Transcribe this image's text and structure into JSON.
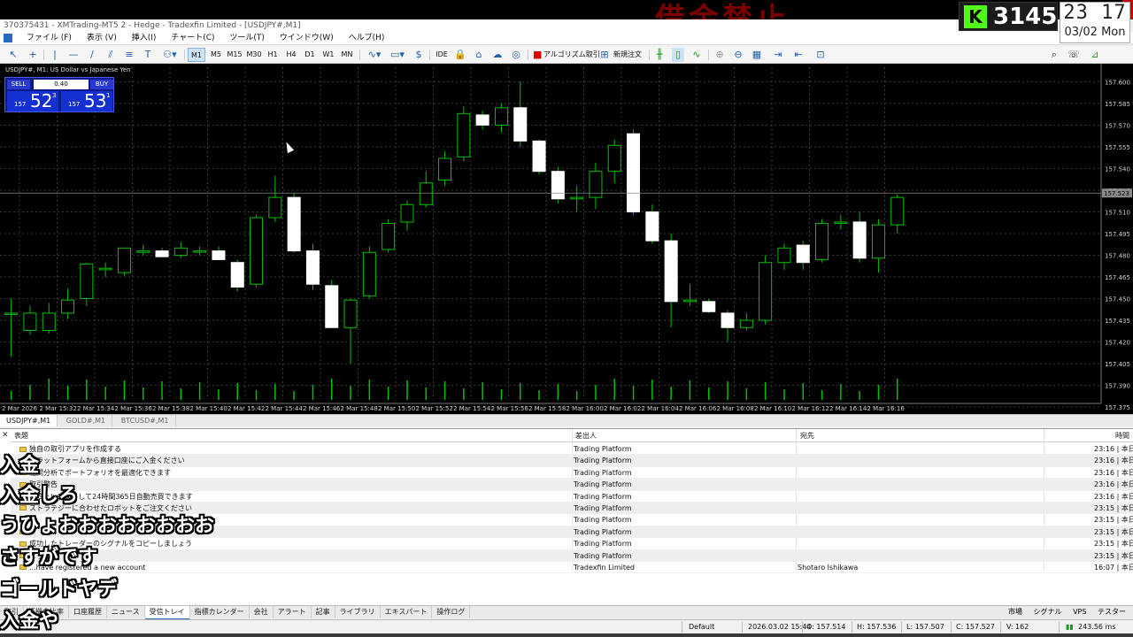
{
  "stream": {
    "banner_text": "借金禁止",
    "viewer_count": "3145",
    "viewer_logo": "K",
    "clock_time": "23 17",
    "clock_date": "03/02 Mon"
  },
  "window": {
    "title": "370375431 - XMTrading-MT5 2 - Hedge - Tradexfin Limited - [USDJPY#,M1]"
  },
  "menu": [
    "ファイル (F)",
    "表示 (V)",
    "挿入(I)",
    "チャート(C)",
    "ツール(T)",
    "ウインドウ(W)",
    "ヘルプ(H)"
  ],
  "toolbar": {
    "timeframes": [
      "M1",
      "M5",
      "M15",
      "M30",
      "H1",
      "H4",
      "D1",
      "W1",
      "MN"
    ],
    "active_timeframe": "M1",
    "ide_label": "IDE",
    "algo_label": "アルゴリズム取引",
    "new_order_label": "新規注文"
  },
  "chart": {
    "title": "USDJPY#, M1: US Dollar vs Japanese Yen",
    "sell_label": "SELL",
    "buy_label": "BUY",
    "lot": "0.40",
    "sell_prefix": "157",
    "sell_big": "52",
    "sell_sup": "3",
    "buy_prefix": "157",
    "buy_big": "53",
    "buy_sup": "1",
    "current_price_label": "157.523",
    "background": "#000000",
    "grid_color": "#3a3a3a",
    "candle_up_color": "#000000",
    "candle_down_color": "#ffffff",
    "wick_color": "#00c000"
  },
  "chart_data": {
    "type": "candlestick",
    "title": "USDJPY#, M1: US Dollar vs Japanese Yen",
    "ylim": [
      157.38,
      157.61
    ],
    "y_ticks": [
      "157.600",
      "157.585",
      "157.570",
      "157.555",
      "157.540",
      "157.525",
      "157.510",
      "157.495",
      "157.480",
      "157.465",
      "157.450",
      "157.435",
      "157.420",
      "157.405",
      "157.390",
      "157.375"
    ],
    "x_ticks": [
      "2 Mar 2026",
      "2 Mar 15:32",
      "2 Mar 15:34",
      "2 Mar 15:36",
      "2 Mar 15:38",
      "2 Mar 15:40",
      "2 Mar 15:42",
      "2 Mar 15:44",
      "2 Mar 15:46",
      "2 Mar 15:48",
      "2 Mar 15:50",
      "2 Mar 15:52",
      "2 Mar 15:54",
      "2 Mar 15:56",
      "2 Mar 15:58",
      "2 Mar 16:00",
      "2 Mar 16:02",
      "2 Mar 16:04",
      "2 Mar 16:06",
      "2 Mar 16:08",
      "2 Mar 16:10",
      "2 Mar 16:12",
      "2 Mar 16:14",
      "2 Mar 16:16"
    ],
    "candles": [
      {
        "o": 157.44,
        "h": 157.45,
        "l": 157.41,
        "c": 157.44
      },
      {
        "o": 157.428,
        "h": 157.445,
        "l": 157.425,
        "c": 157.44
      },
      {
        "o": 157.428,
        "h": 157.447,
        "l": 157.426,
        "c": 157.44
      },
      {
        "o": 157.44,
        "h": 157.457,
        "l": 157.436,
        "c": 157.449
      },
      {
        "o": 157.45,
        "h": 157.475,
        "l": 157.445,
        "c": 157.474
      },
      {
        "o": 157.47,
        "h": 157.475,
        "l": 157.465,
        "c": 157.471
      },
      {
        "o": 157.468,
        "h": 157.482,
        "l": 157.466,
        "c": 157.485
      },
      {
        "o": 157.482,
        "h": 157.487,
        "l": 157.48,
        "c": 157.483
      },
      {
        "o": 157.483,
        "h": 157.485,
        "l": 157.479,
        "c": 157.479
      },
      {
        "o": 157.48,
        "h": 157.489,
        "l": 157.478,
        "c": 157.485
      },
      {
        "o": 157.483,
        "h": 157.486,
        "l": 157.48,
        "c": 157.483
      },
      {
        "o": 157.483,
        "h": 157.486,
        "l": 157.477,
        "c": 157.477
      },
      {
        "o": 157.475,
        "h": 157.477,
        "l": 157.455,
        "c": 157.458
      },
      {
        "o": 157.46,
        "h": 157.508,
        "l": 157.458,
        "c": 157.506
      },
      {
        "o": 157.506,
        "h": 157.535,
        "l": 157.503,
        "c": 157.52
      },
      {
        "o": 157.52,
        "h": 157.523,
        "l": 157.482,
        "c": 157.483
      },
      {
        "o": 157.483,
        "h": 157.488,
        "l": 157.456,
        "c": 157.46
      },
      {
        "o": 157.459,
        "h": 157.463,
        "l": 157.43,
        "c": 157.43
      },
      {
        "o": 157.43,
        "h": 157.45,
        "l": 157.405,
        "c": 157.449
      },
      {
        "o": 157.452,
        "h": 157.486,
        "l": 157.45,
        "c": 157.482
      },
      {
        "o": 157.484,
        "h": 157.505,
        "l": 157.482,
        "c": 157.502
      },
      {
        "o": 157.503,
        "h": 157.518,
        "l": 157.497,
        "c": 157.515
      },
      {
        "o": 157.515,
        "h": 157.538,
        "l": 157.513,
        "c": 157.53
      },
      {
        "o": 157.532,
        "h": 157.552,
        "l": 157.528,
        "c": 157.547
      },
      {
        "o": 157.548,
        "h": 157.583,
        "l": 157.545,
        "c": 157.578
      },
      {
        "o": 157.577,
        "h": 157.58,
        "l": 157.567,
        "c": 157.57
      },
      {
        "o": 157.57,
        "h": 157.585,
        "l": 157.565,
        "c": 157.582
      },
      {
        "o": 157.582,
        "h": 157.6,
        "l": 157.555,
        "c": 157.559
      },
      {
        "o": 157.559,
        "h": 157.56,
        "l": 157.536,
        "c": 157.538
      },
      {
        "o": 157.538,
        "h": 157.541,
        "l": 157.516,
        "c": 157.519
      },
      {
        "o": 157.519,
        "h": 157.528,
        "l": 157.51,
        "c": 157.52
      },
      {
        "o": 157.52,
        "h": 157.544,
        "l": 157.512,
        "c": 157.538
      },
      {
        "o": 157.538,
        "h": 157.56,
        "l": 157.53,
        "c": 157.556
      },
      {
        "o": 157.564,
        "h": 157.567,
        "l": 157.508,
        "c": 157.51
      },
      {
        "o": 157.51,
        "h": 157.515,
        "l": 157.488,
        "c": 157.49
      },
      {
        "o": 157.49,
        "h": 157.495,
        "l": 157.43,
        "c": 157.448
      },
      {
        "o": 157.448,
        "h": 157.46,
        "l": 157.445,
        "c": 157.449
      },
      {
        "o": 157.448,
        "h": 157.45,
        "l": 157.44,
        "c": 157.441
      },
      {
        "o": 157.44,
        "h": 157.442,
        "l": 157.42,
        "c": 157.43
      },
      {
        "o": 157.43,
        "h": 157.44,
        "l": 157.428,
        "c": 157.435
      },
      {
        "o": 157.435,
        "h": 157.48,
        "l": 157.432,
        "c": 157.475
      },
      {
        "o": 157.475,
        "h": 157.488,
        "l": 157.47,
        "c": 157.485
      },
      {
        "o": 157.487,
        "h": 157.49,
        "l": 157.47,
        "c": 157.475
      },
      {
        "o": 157.477,
        "h": 157.505,
        "l": 157.475,
        "c": 157.502
      },
      {
        "o": 157.502,
        "h": 157.508,
        "l": 157.498,
        "c": 157.503
      },
      {
        "o": 157.503,
        "h": 157.51,
        "l": 157.475,
        "c": 157.478
      },
      {
        "o": 157.478,
        "h": 157.505,
        "l": 157.468,
        "c": 157.501
      },
      {
        "o": 157.501,
        "h": 157.522,
        "l": 157.495,
        "c": 157.52
      }
    ]
  },
  "chart_tabs": [
    "USDJPY#,M1",
    "GOLD#,M1",
    "BTCUSD#,M1"
  ],
  "mailbox": {
    "columns": [
      "表題",
      "差出人",
      "宛先",
      "時間"
    ],
    "rows": [
      {
        "subject": "独自の取引アプリを作成する",
        "from": "Trading Platform",
        "to": "",
        "time": "23:16 | 本日"
      },
      {
        "subject": "プラットフォームから直接口座にご入金ください",
        "from": "Trading Platform",
        "to": "",
        "time": "23:16 | 本日"
      },
      {
        "subject": "相関分析でポートフォリオを最適化できます",
        "from": "Trading Platform",
        "to": "",
        "time": "23:16 | 本日"
      },
      {
        "subject": "取引警告",
        "from": "Trading Platform",
        "to": "",
        "time": "23:16 | 本日"
      },
      {
        "subject": "VPSをレンタルして24時間365日自動売買できます",
        "from": "Trading Platform",
        "to": "",
        "time": "23:16 | 本日"
      },
      {
        "subject": "ストラテジーに合わせたロボットをご注文ください",
        "from": "Trading Platform",
        "to": "",
        "time": "23:15 | 本日"
      },
      {
        "subject": "",
        "from": "Trading Platform",
        "to": "",
        "time": "23:15 | 本日"
      },
      {
        "subject": "",
        "from": "Trading Platform",
        "to": "",
        "time": "23:15 | 本日"
      },
      {
        "subject": "成功したトレーダーのシグナルをコピーしましょう",
        "from": "Trading Platform",
        "to": "",
        "time": "23:15 | 本日"
      },
      {
        "subject": "ようこそ",
        "from": "Trading Platform",
        "to": "",
        "time": "23:15 | 本日"
      },
      {
        "subject": "...have registered a new account",
        "from": "Tradexfin Limited",
        "to": "Shotaro Ishikawa",
        "time": "16:07 | 本日"
      }
    ]
  },
  "bottom_tabs": [
    "取引",
    "証拠金比率",
    "口座履歴",
    "ニュース",
    "受信トレイ",
    "指標カレンダー",
    "会社",
    "アラート",
    "記事",
    "ライブラリ",
    "エキスパート",
    "操作ログ"
  ],
  "active_bottom_tab": "受信トレイ",
  "bottom_right": [
    "市場",
    "シグナル",
    "VPS",
    "テスター"
  ],
  "statusbar": {
    "profile": "Default",
    "datetime": "2026.03.02 15:44",
    "open": "O: 157.514",
    "high": "H: 157.536",
    "low": "L: 157.507",
    "close": "C: 157.527",
    "volume": "V: 162",
    "ping": "243.56 ms"
  },
  "chat_messages": [
    "入金",
    "入金しろ",
    "うひょおおおおおおおお",
    "さすがです",
    "ゴールドヤデ",
    "入金や"
  ]
}
